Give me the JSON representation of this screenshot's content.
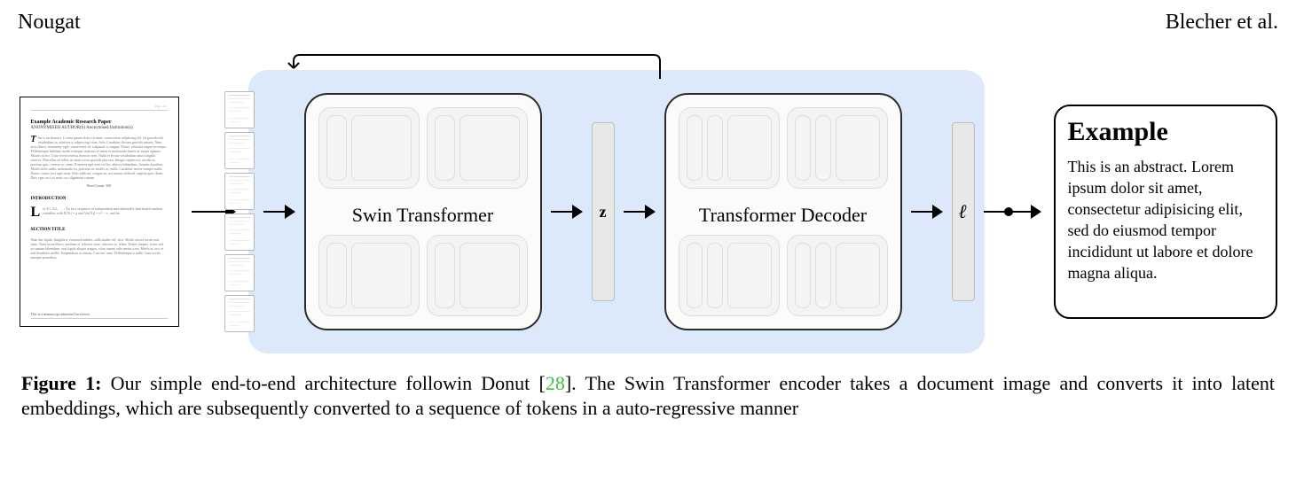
{
  "header": {
    "left": "Nougat",
    "right": "Blecher et al."
  },
  "doc": {
    "top_left": "",
    "top_right": "Page 1 of 1",
    "title": "Example Academic Research Paper",
    "authors": "ANONYMISED AUTHOR(S)  Anonymised Institution(s)",
    "abstract": "his is an abstract. Lorem ipsum dolor sit amet, consectetur adipiscing elit. In gravida elit vestibulum in, ultricies a, adipiscing vitae, felis. Curabitur dictum gravida mauris. Nam arcu libero, nonummy eget, consectetur id, vulputate a, magna. Donec vehicula augue eu neque. Pellentesque habitant morbi tristique senectus et netus et malesuada fames ac turpis egestas. Mauris ut leo. Cras viverra metus rhoncus sem. Nulla et lectus vestibulum urna fringilla ultrices. Phasellus eu tellus sit amet tortor gravida placerat. Integer sapien est, iaculis in, pretium quis, viverra ac, nunc. Praesent eget sem vel leo ultrices bibendum. Aenean faucibus. Morbi dolor nulla, malesuada eu, pulvinar at, mollis ac, nulla. Curabitur auctor semper nulla. Donec varius orci eget risus. Duis nibh mi, congue eu, accumsan eleifend, sagittis quis, diam. Duis eget orci sit amet orci dignissim rutrum.",
    "word_count": "Word Count:  500",
    "h_intro": "INTRODUCTION",
    "intro_text": "et X1, X2, . . . , Xn be a sequence of independent and identically distributed random variables with E[Xi] = μ and Var[Xi] = σ² < ∞, and let",
    "h_section": "SECTION TITLE",
    "section_text": "Nam dui ligula, fringilla a, euismod sodales, sollicitudin vel, wisi. Morbi auctor lorem non justo. Nam lacus libero, pretium at, lobortis vitae, ultricies et, tellus. Donec aliquet, tortor sed accumsan bibendum, erat ligula aliquet magna, vitae ornare odio metus a mi. Morbi ac orci et nisl hendrerit mollis. Suspendisse ut massa. Cras nec ante. Pellentesque a nulla. Cum sociis natoque penatibus.",
    "footer": "This is a manuscript submitted for review."
  },
  "modules": {
    "encoder": "Swin Transformer",
    "decoder": "Transformer Decoder"
  },
  "latent": {
    "z": "z",
    "l": "ℓ"
  },
  "output": {
    "title": "Example",
    "body": "This is an abstract. Lorem ipsum dolor sit amet, consectetur adipisicing elit, sed do eiusmod tempor incididunt ut labore et dolore magna aliqua."
  },
  "caption": {
    "label": "Figure 1:",
    "text_a": " Our simple end-to-end architecture followin Donut [",
    "ref": "28",
    "text_b": "]. The Swin Transformer encoder takes a document image and converts it into latent embeddings, which are subsequently converted to a sequence of tokens in a auto-regressive manner"
  }
}
